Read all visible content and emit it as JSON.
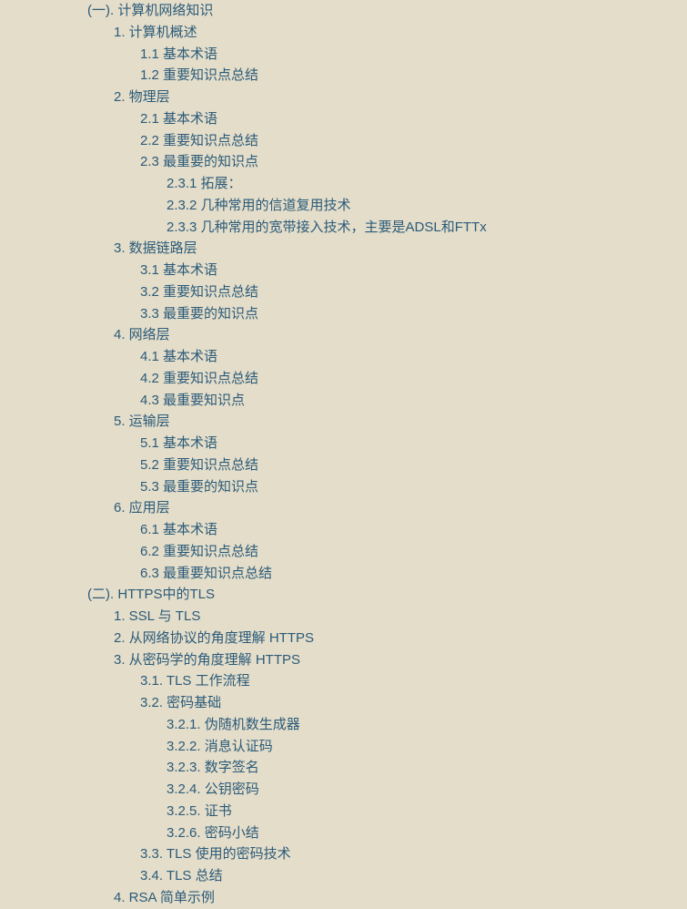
{
  "toc": [
    {
      "level": 0,
      "text": "(一). 计算机网络知识"
    },
    {
      "level": 1,
      "text": "1. 计算机概述"
    },
    {
      "level": 2,
      "text": "1.1 基本术语"
    },
    {
      "level": 2,
      "text": "1.2 重要知识点总结"
    },
    {
      "level": 1,
      "text": "2. 物理层"
    },
    {
      "level": 2,
      "text": "2.1 基本术语"
    },
    {
      "level": 2,
      "text": "2.2 重要知识点总结"
    },
    {
      "level": 2,
      "text": "2.3 最重要的知识点"
    },
    {
      "level": 3,
      "text": "2.3.1 拓展："
    },
    {
      "level": 3,
      "text": "2.3.2 几种常用的信道复用技术"
    },
    {
      "level": 3,
      "text": "2.3.3 几种常用的宽带接入技术，主要是ADSL和FTTx"
    },
    {
      "level": 1,
      "text": "3. 数据链路层"
    },
    {
      "level": 2,
      "text": "3.1 基本术语"
    },
    {
      "level": 2,
      "text": "3.2 重要知识点总结"
    },
    {
      "level": 2,
      "text": "3.3 最重要的知识点"
    },
    {
      "level": 1,
      "text": "4. 网络层"
    },
    {
      "level": 2,
      "text": "4.1 基本术语"
    },
    {
      "level": 2,
      "text": "4.2 重要知识点总结"
    },
    {
      "level": 2,
      "text": "4.3 最重要知识点"
    },
    {
      "level": 1,
      "text": "5. 运输层"
    },
    {
      "level": 2,
      "text": "5.1 基本术语"
    },
    {
      "level": 2,
      "text": "5.2 重要知识点总结"
    },
    {
      "level": 2,
      "text": "5.3 最重要的知识点"
    },
    {
      "level": 1,
      "text": "6. 应用层"
    },
    {
      "level": 2,
      "text": "6.1 基本术语"
    },
    {
      "level": 2,
      "text": "6.2 重要知识点总结"
    },
    {
      "level": 2,
      "text": "6.3 最重要知识点总结"
    },
    {
      "level": 0,
      "text": "(二). HTTPS中的TLS"
    },
    {
      "level": 1,
      "text": "1. SSL 与 TLS"
    },
    {
      "level": 1,
      "text": "2. 从网络协议的角度理解 HTTPS"
    },
    {
      "level": 1,
      "text": "3. 从密码学的角度理解 HTTPS"
    },
    {
      "level": 2,
      "text": "3.1. TLS 工作流程"
    },
    {
      "level": 2,
      "text": "3.2. 密码基础"
    },
    {
      "level": 3,
      "text": "3.2.1. 伪随机数生成器"
    },
    {
      "level": 3,
      "text": "3.2.2. 消息认证码"
    },
    {
      "level": 3,
      "text": "3.2.3. 数字签名"
    },
    {
      "level": 3,
      "text": "3.2.4. 公钥密码"
    },
    {
      "level": 3,
      "text": "3.2.5. 证书"
    },
    {
      "level": 3,
      "text": "3.2.6. 密码小结"
    },
    {
      "level": 2,
      "text": "3.3. TLS 使用的密码技术"
    },
    {
      "level": 2,
      "text": "3.4. TLS 总结"
    },
    {
      "level": 1,
      "text": "4. RSA 简单示例"
    }
  ]
}
